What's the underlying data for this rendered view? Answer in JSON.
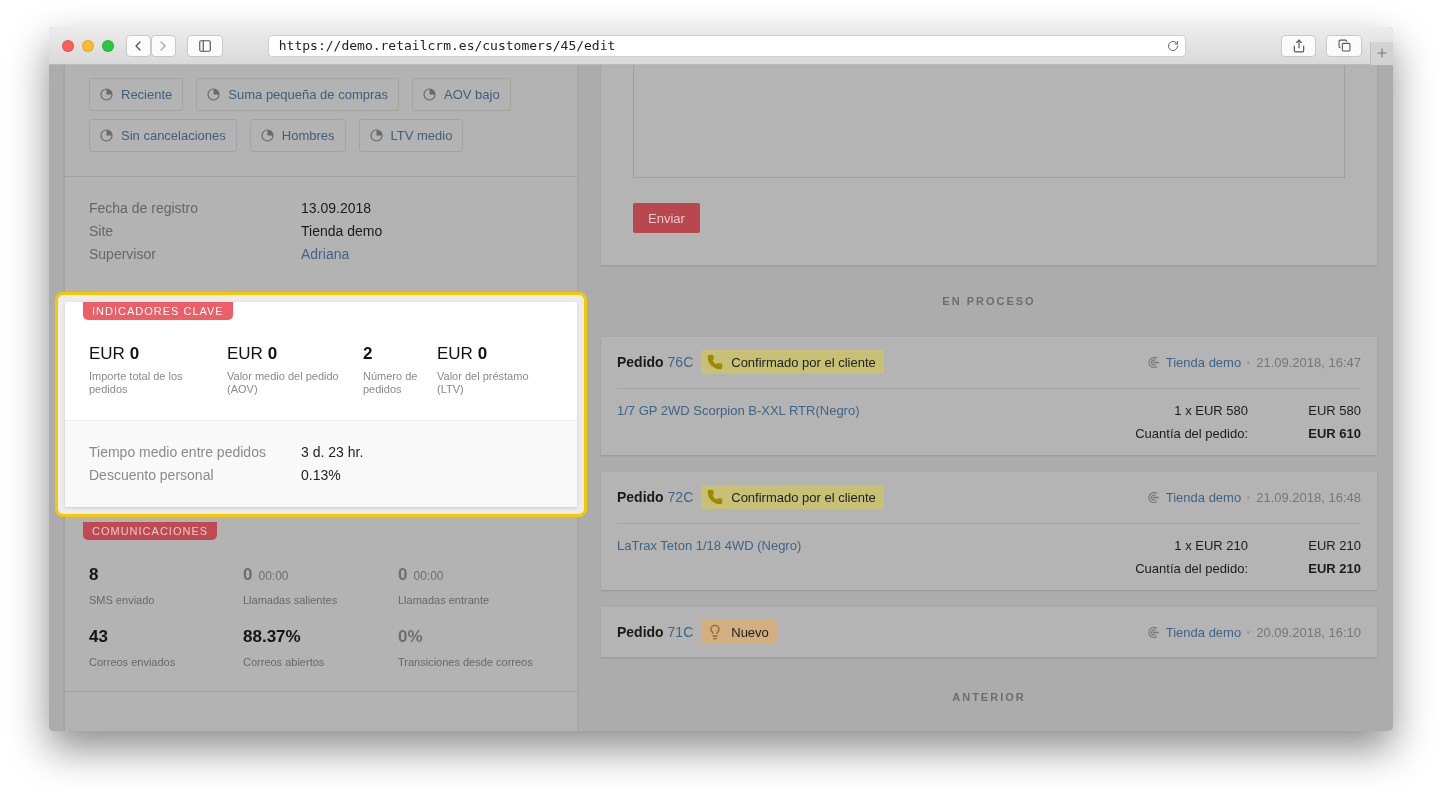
{
  "browser": {
    "url": "https://demo.retailcrm.es/customers/45/edit"
  },
  "segments": [
    {
      "label": "Reciente"
    },
    {
      "label": "Suma pequeña de compras"
    },
    {
      "label": "AOV bajo"
    },
    {
      "label": "Sin cancelaciones"
    },
    {
      "label": "Hombres"
    },
    {
      "label": "LTV medio"
    }
  ],
  "info": [
    {
      "label": "Fecha de registro",
      "value": "13.09.2018",
      "kind": "text"
    },
    {
      "label": "Site",
      "value": "Tienda demo",
      "kind": "text"
    },
    {
      "label": "Supervisor",
      "value": "Adriana",
      "kind": "link"
    }
  ],
  "key_indicators": {
    "badge": "INDICADORES CLAVE",
    "metrics": [
      {
        "value": "EUR **0**",
        "label": "Importe total de los pedidos"
      },
      {
        "value": "EUR **0**",
        "label": "Valor medio del pedido (AOV)"
      },
      {
        "value": "**2**",
        "label": "Número de pedidos"
      },
      {
        "value": "EUR **0**",
        "label": "Valor del préstamo (LTV)"
      }
    ],
    "details": [
      {
        "label": "Tiempo medio entre pedidos",
        "value": "3 d. 23 hr."
      },
      {
        "label": "Descuento personal",
        "value": "0.13%"
      }
    ]
  },
  "communications": {
    "badge": "COMUNICACIONES",
    "stats": [
      {
        "value": "8",
        "label": "SMS enviado",
        "muted": false
      },
      {
        "value": "0",
        "time": "00:00",
        "label": "Llamadas salientes",
        "muted": true
      },
      {
        "value": "0",
        "time": "00:00",
        "label": "Llamadas entrante",
        "muted": true
      },
      {
        "value": "43",
        "label": "Correos enviados",
        "muted": false
      },
      {
        "value": "88.37%",
        "label": "Correos abiertos",
        "muted": false
      },
      {
        "value": "0%",
        "label": "Transiciones desde correos",
        "muted": true
      }
    ]
  },
  "send_button": "Enviar",
  "in_progress": {
    "heading": "EN PROCESO",
    "orders": [
      {
        "label": "Pedido",
        "number": "76C",
        "status": {
          "text": "Confirmado por el cliente",
          "kind": "phone",
          "color": "#c8c074"
        },
        "store": "Tienda demo",
        "date": "21.09.2018, 16:47",
        "items": [
          {
            "name": "1/7 GP 2WD Scorpion B-XXL RTR(Negro)",
            "quantity": "1 x EUR 580",
            "total": "EUR 580"
          }
        ],
        "sum_label": "Cuantía del pedido:",
        "sum": "EUR 610"
      },
      {
        "label": "Pedido",
        "number": "72C",
        "status": {
          "text": "Confirmado por el cliente",
          "kind": "phone",
          "color": "#c8c074"
        },
        "store": "Tienda demo",
        "date": "21.09.2018, 16:48",
        "items": [
          {
            "name": "LaTrax Teton 1/18 4WD (Negro)",
            "quantity": "1 x EUR 210",
            "total": "EUR 210"
          }
        ],
        "sum_label": "Cuantía del pedido:",
        "sum": "EUR 210"
      },
      {
        "label": "Pedido",
        "number": "71C",
        "status": {
          "text": "Nuevo",
          "kind": "bulb",
          "color": "#d2ae80"
        },
        "store": "Tienda demo",
        "date": "20.09.2018, 16:10"
      }
    ]
  },
  "previous": {
    "heading": "ANTERIOR"
  }
}
